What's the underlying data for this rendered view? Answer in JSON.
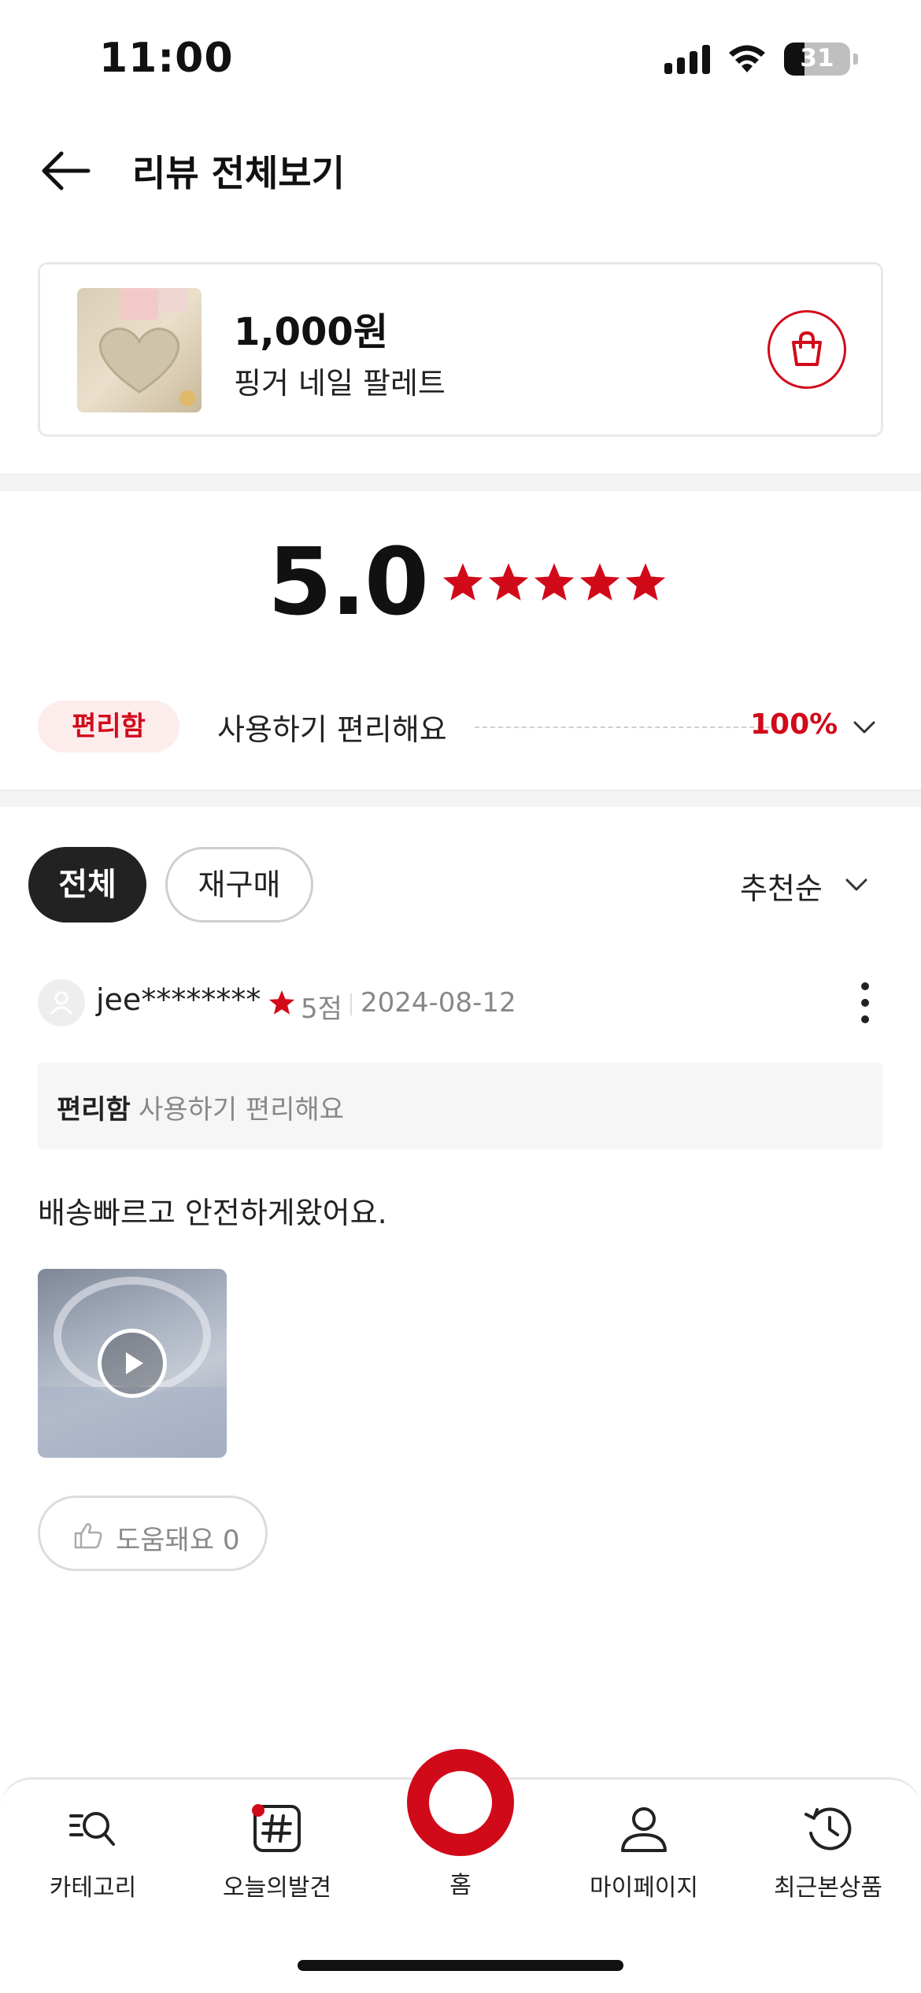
{
  "status_bar": {
    "time": "11:00",
    "battery": "31",
    "battery_level": 0.31
  },
  "header": {
    "title": "리뷰 전체보기",
    "back_icon": "arrow-left-icon"
  },
  "product": {
    "price": "1,000원",
    "name": "핑거 네일 팔레트",
    "cart_icon": "shopping-bag-icon"
  },
  "rating": {
    "score": "5.0",
    "stars": 5,
    "star_color": "#d10a1a"
  },
  "keyword": {
    "badge": "편리함",
    "text": "사용하기 편리해요",
    "percent": "100%"
  },
  "filters": {
    "all": "전체",
    "rebuy": "재구매",
    "sort": "추천순"
  },
  "review": {
    "user": "jee********",
    "score": "5점",
    "date": "2024-08-12",
    "tag_key": "편리함",
    "tag_value": "사용하기 편리해요",
    "body": "배송빠르고 안전하게왔어요.",
    "helpful": "도움돼요 0"
  },
  "bottom_nav": {
    "items": [
      {
        "label": "카테고리",
        "icon": "category-search-icon"
      },
      {
        "label": "오늘의발견",
        "icon": "hashtag-icon"
      },
      {
        "label": "홈",
        "icon": "home-circle-icon"
      },
      {
        "label": "마이페이지",
        "icon": "person-icon"
      },
      {
        "label": "최근본상품",
        "icon": "history-icon"
      }
    ]
  },
  "colors": {
    "accent": "#d10a1a",
    "text": "#111111",
    "muted": "#888888"
  }
}
